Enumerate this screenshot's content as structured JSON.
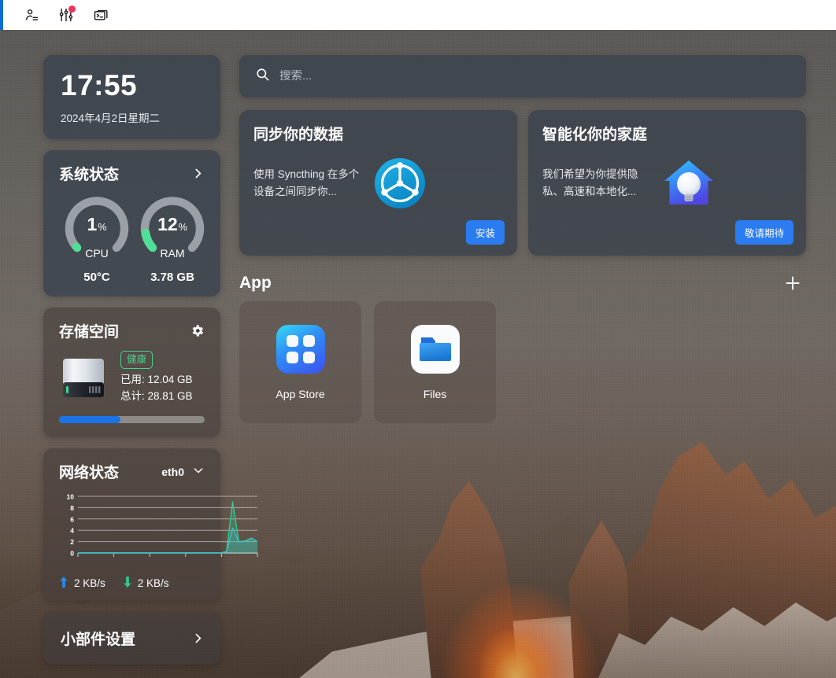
{
  "topbar": {
    "icons": [
      {
        "name": "user-account-icon",
        "label": "用户"
      },
      {
        "name": "sliders-settings-icon",
        "label": "设置",
        "badge": true
      },
      {
        "name": "terminal-console-icon",
        "label": "终端"
      }
    ]
  },
  "clock": {
    "time": "17:55",
    "date": "2024年4月2日星期二"
  },
  "system": {
    "title": "系统状态",
    "gauges": [
      {
        "label": "CPU",
        "value": "1",
        "unit": "%",
        "percent": 1,
        "sub": "50°C"
      },
      {
        "label": "RAM",
        "value": "12",
        "unit": "%",
        "percent": 12,
        "sub": "3.78 GB"
      }
    ],
    "accent_color": "#4fe096",
    "track_color": "#9aa0a6"
  },
  "storage": {
    "title": "存储空间",
    "health_badge": "健康",
    "used_label": "已用: 12.04 GB",
    "total_label": "总计: 28.81 GB",
    "used_percent": 42,
    "bar_color": "#1a73e8"
  },
  "network": {
    "title": "网络状态",
    "interface": "eth0",
    "upload": "2 KB/s",
    "download": "2 KB/s",
    "upload_color": "#2a8cf0",
    "download_color": "#2ecc8f",
    "chart_data": {
      "type": "line",
      "title": "网络状态",
      "xlabel": "",
      "ylabel": "",
      "ylim": [
        0,
        10
      ],
      "yticks": [
        0,
        2,
        4,
        6,
        8,
        10
      ],
      "grid": true,
      "legend": "none",
      "x": [
        0,
        1,
        2,
        3,
        4,
        5,
        6,
        7,
        8,
        9,
        10,
        11,
        12,
        13,
        14,
        15,
        16,
        17,
        18,
        19,
        20,
        21,
        22,
        23,
        24,
        25,
        26,
        27,
        28,
        29
      ],
      "series": [
        {
          "name": "upload",
          "color": "#2ecc8f",
          "values": [
            0,
            0,
            0,
            0,
            0,
            0,
            0,
            0,
            0,
            0,
            0,
            0,
            0,
            0,
            0,
            0,
            0,
            0,
            0,
            0,
            0,
            0,
            0,
            0,
            0.2,
            9,
            2,
            2.1,
            2.6,
            2
          ]
        },
        {
          "name": "download",
          "color": "#3fc0c8",
          "values": [
            0,
            0,
            0,
            0,
            0,
            0,
            0,
            0,
            0,
            0,
            0,
            0,
            0,
            0,
            0,
            0,
            0,
            0,
            0,
            0,
            0,
            0,
            0,
            0,
            0.2,
            4.4,
            2,
            2,
            2.6,
            2
          ]
        }
      ]
    }
  },
  "widget_settings": {
    "title": "小部件设置"
  },
  "search": {
    "placeholder": "搜索...",
    "value": ""
  },
  "promos": [
    {
      "title": "同步你的数据",
      "description": "使用 Syncthing 在多个设备之间同步你...",
      "button": "安装",
      "icon": "syncthing-icon"
    },
    {
      "title": "智能化你的家庭",
      "description": "我们希望为你提供隐私、高速和本地化...",
      "button": "敬请期待",
      "icon": "smart-home-icon"
    }
  ],
  "apps": {
    "heading": "App",
    "add_label": "+",
    "items": [
      {
        "label": "App Store",
        "icon": "app-store-icon"
      },
      {
        "label": "Files",
        "icon": "files-folder-icon"
      }
    ]
  }
}
